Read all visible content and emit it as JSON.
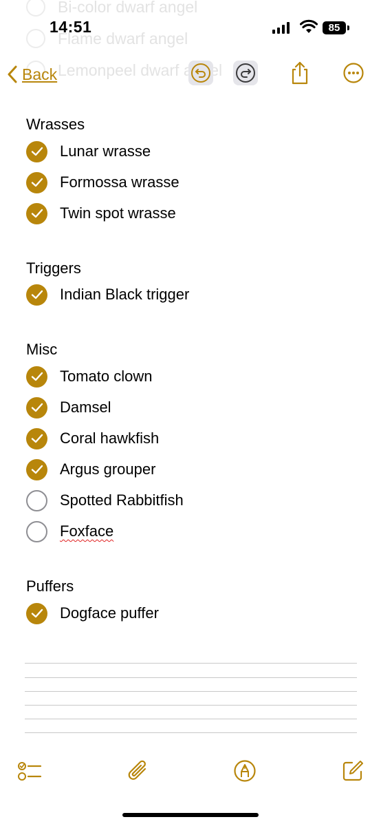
{
  "ghost_rows": [
    "Bi-color dwarf angel",
    "Flame dwarf angel",
    "Lemonpeel dwarf angel"
  ],
  "status_bar": {
    "time": "14:51",
    "battery": "85"
  },
  "nav": {
    "back_label": "Back"
  },
  "sections": [
    {
      "title": "Wrasses",
      "items": [
        {
          "label": "Lunar wrasse",
          "checked": true
        },
        {
          "label": "Formossa wrasse",
          "checked": true
        },
        {
          "label": "Twin spot wrasse",
          "checked": true
        }
      ]
    },
    {
      "title": "Triggers",
      "items": [
        {
          "label": "Indian Black trigger",
          "checked": true
        }
      ]
    },
    {
      "title": "Misc",
      "items": [
        {
          "label": "Tomato clown",
          "checked": true
        },
        {
          "label": "Damsel",
          "checked": true
        },
        {
          "label": "Coral hawkfish",
          "checked": true
        },
        {
          "label": "Argus grouper",
          "checked": true
        },
        {
          "label": "Spotted Rabbitfish",
          "checked": false
        },
        {
          "label": "Foxface",
          "checked": false
        }
      ]
    },
    {
      "title": "Puffers",
      "items": [
        {
          "label": "Dogface puffer",
          "checked": true
        }
      ]
    }
  ],
  "colors": {
    "accent": "#b8860b",
    "unchecked_ring": "#8e8e93",
    "rule": "#c8c8c8"
  },
  "icons": {
    "toolbar": [
      "undo-icon",
      "redo-icon",
      "share-icon",
      "more-icon"
    ],
    "bottom": [
      "checklist-icon",
      "paperclip-icon",
      "markup-pen-icon",
      "compose-icon"
    ]
  }
}
